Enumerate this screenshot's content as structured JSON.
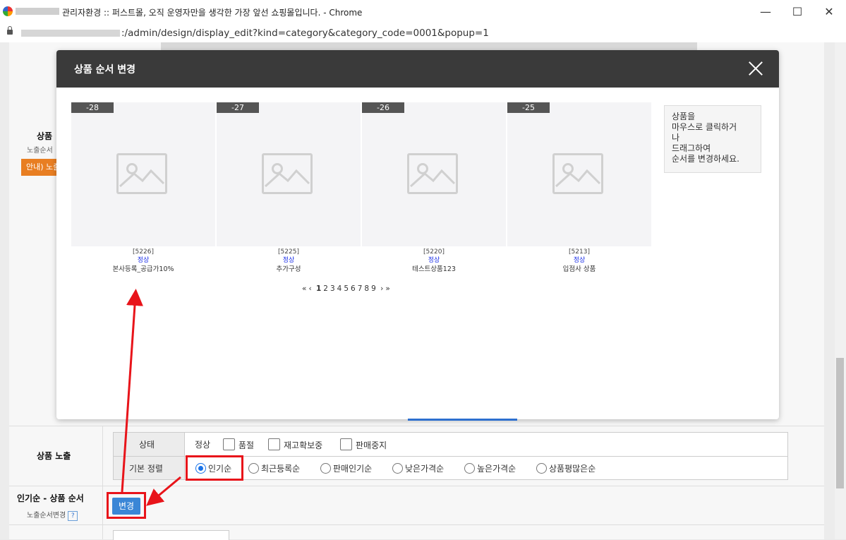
{
  "window": {
    "title": "관리자환경 :: 퍼스트몰, 오직 운영자만을 생각한 가장 앞선 쇼핑몰입니다. - Chrome",
    "url": ":/admin/design/display_edit?kind=category&category_code=0001&popup=1",
    "minimize_label": "—",
    "maximize_label": "☐",
    "close_label": "✕"
  },
  "background_page": {
    "section_label": "상품",
    "section_sub": "노출순서",
    "orange_btn": "안내) 노출"
  },
  "modal": {
    "title": "상품 순서 변경",
    "help_text": "상품을\n마우스로 클릭하거\n나\n드래그하여\n순서를 변경하세요.",
    "products": [
      {
        "rank": "-28",
        "code": "[5226]",
        "status": "정상",
        "name": "본사등록_공급가10%"
      },
      {
        "rank": "-27",
        "code": "[5225]",
        "status": "정상",
        "name": "추가구성"
      },
      {
        "rank": "-26",
        "code": "[5220]",
        "status": "정상",
        "name": "테스트상품123"
      },
      {
        "rank": "-25",
        "code": "[5213]",
        "status": "정상",
        "name": "입점사 상품"
      }
    ],
    "pager": {
      "first": "«",
      "prev": "‹",
      "pages": [
        "1",
        "2",
        "3",
        "4",
        "5",
        "6",
        "7",
        "8",
        "9"
      ],
      "current": "1",
      "next": "›",
      "last": "»"
    }
  },
  "form": {
    "expose_label": "상품 노출",
    "status_header": "상태",
    "status_default": "정상",
    "status_options": [
      "품절",
      "재고확보중",
      "판매중지"
    ],
    "sort_header": "기본 정렬",
    "sort_options": [
      "인기순",
      "최근등록순",
      "판매인기순",
      "낮은가격순",
      "높은가격순",
      "상품평많은순"
    ],
    "sort_selected": "인기순",
    "popular_label": "인기순 - 상품 순서",
    "popular_sub": "노출순서변경",
    "help_mark": "?",
    "change_button": "변경"
  },
  "colors": {
    "modal_header": "#3a3a3a",
    "accent_blue": "#3a86d6",
    "status_blue": "#1a2ee8",
    "annotation_red": "#e8141a",
    "orange": "#e87e22"
  }
}
